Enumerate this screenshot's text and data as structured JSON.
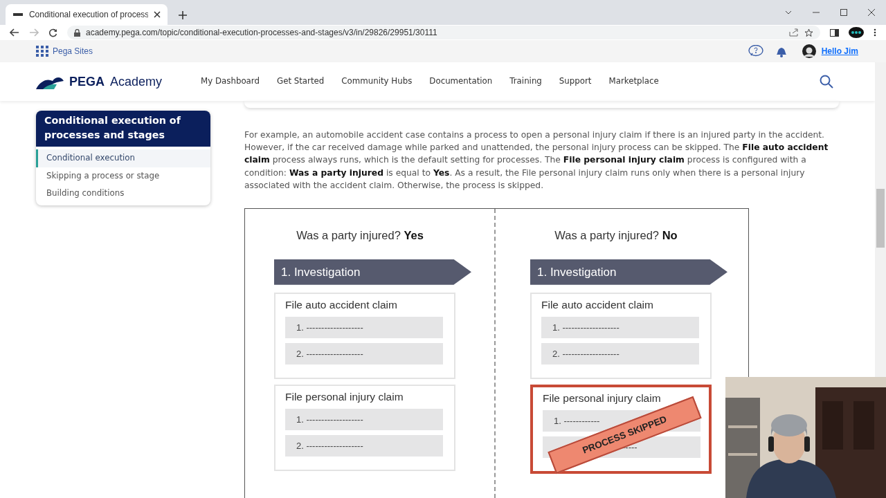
{
  "browser": {
    "tab_title": "Conditional execution of process",
    "url": "academy.pega.com/topic/conditional-execution-processes-and-stages/v3/in/29826/29951/30111"
  },
  "pega_bar": {
    "sites_label": "Pega Sites",
    "greeting": "Hello Jim"
  },
  "nav": {
    "logo_brand": "PEGA",
    "logo_product": "Academy",
    "items": [
      "My Dashboard",
      "Get Started",
      "Community Hubs",
      "Documentation",
      "Training",
      "Support",
      "Marketplace"
    ]
  },
  "sidebar": {
    "title": "Conditional execution of processes and stages",
    "items": [
      {
        "label": "Conditional execution",
        "selected": true
      },
      {
        "label": "Skipping a process or stage",
        "selected": false
      },
      {
        "label": "Building conditions",
        "selected": false
      }
    ]
  },
  "article": {
    "paragraph": "For example, an automobile accident case contains a process to open a personal injury claim if there is an injured party in the accident. However, if the car received damage while parked and unattended, the personal injury process can be skipped. The **File auto accident claim** process always runs, which is the default setting for processes. The **File personal injury claim** process is configured with a condition: **Was a party injured** is equal to **Yes**. As a result, the File personal injury claim runs only when there is a personal injury associated with the accident claim. Otherwise, the process is skipped."
  },
  "diagram": {
    "columns": [
      {
        "question": "Was a party injured? **Yes**",
        "stage": "1. Investigation",
        "processes": [
          {
            "name": "File auto accident claim",
            "skipped": false,
            "steps": [
              "1. -------------------",
              "2. -------------------"
            ]
          },
          {
            "name": "File personal injury claim",
            "skipped": false,
            "steps": [
              "1. -------------------",
              "2. -------------------"
            ]
          }
        ]
      },
      {
        "question": "Was a party injured? **No**",
        "stage": "1. Investigation",
        "processes": [
          {
            "name": "File auto accident claim",
            "skipped": false,
            "steps": [
              "1. -------------------",
              "2. -------------------"
            ]
          },
          {
            "name": "File personal injury claim",
            "skipped": true,
            "stamp": "PROCESS SKIPPED",
            "steps": [
              "1. ------------",
              "-----"
            ]
          }
        ]
      }
    ]
  }
}
